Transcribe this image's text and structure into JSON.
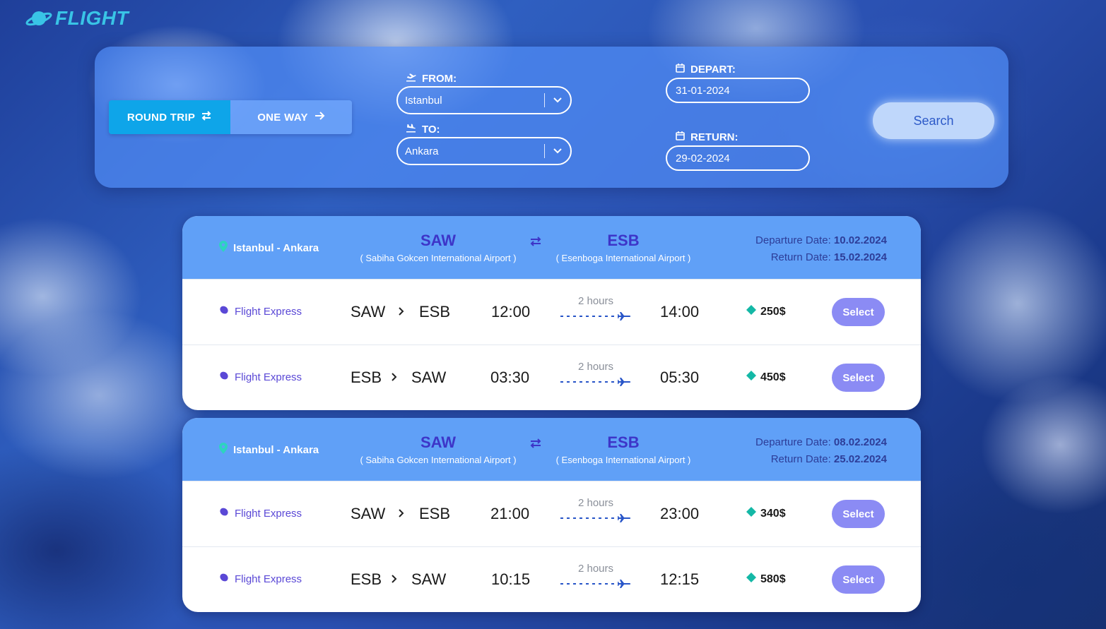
{
  "app": {
    "logo_text": "FLIGHT"
  },
  "search": {
    "trip_types": [
      {
        "label": "ROUND TRIP",
        "active": true
      },
      {
        "label": "ONE WAY",
        "active": false
      }
    ],
    "from_label": "FROM:",
    "from_value": "Istanbul",
    "to_label": "TO:",
    "to_value": "Ankara",
    "depart_label": "DEPART:",
    "depart_value": "31-01-2024",
    "return_label": "RETURN:",
    "return_value": "29-02-2024",
    "search_label": "Search"
  },
  "results": [
    {
      "route": "Istanbul - Ankara",
      "origin_code": "SAW",
      "origin_name": "( Sabiha Gokcen International Airport )",
      "dest_code": "ESB",
      "dest_name": "( Esenboga International Airport )",
      "departure_label": "Departure Date:",
      "departure_date": "10.02.2024",
      "return_label": "Return Date:",
      "return_date": "15.02.2024",
      "flights": [
        {
          "airline": "Flight Express",
          "from": "SAW",
          "to": "ESB",
          "depart": "12:00",
          "duration": "2 hours",
          "arrive": "14:00",
          "price": "250$",
          "action": "Select"
        },
        {
          "airline": "Flight Express",
          "from": "ESB",
          "to": "SAW",
          "depart": "03:30",
          "duration": "2 hours",
          "arrive": "05:30",
          "price": "450$",
          "action": "Select"
        }
      ]
    },
    {
      "route": "Istanbul - Ankara",
      "origin_code": "SAW",
      "origin_name": "( Sabiha Gokcen International Airport )",
      "dest_code": "ESB",
      "dest_name": "( Esenboga International Airport )",
      "departure_label": "Departure Date:",
      "departure_date": "08.02.2024",
      "return_label": "Return Date:",
      "return_date": "25.02.2024",
      "flights": [
        {
          "airline": "Flight Express",
          "from": "SAW",
          "to": "ESB",
          "depart": "21:00",
          "duration": "2 hours",
          "arrive": "23:00",
          "price": "340$",
          "action": "Select"
        },
        {
          "airline": "Flight Express",
          "from": "ESB",
          "to": "SAW",
          "depart": "10:15",
          "duration": "2 hours",
          "arrive": "12:15",
          "price": "580$",
          "action": "Select"
        }
      ]
    }
  ],
  "icons": {
    "logo": "planet-icon",
    "round_trip": "swap-arrows-icon",
    "one_way": "arrow-right-icon",
    "takeoff": "plane-takeoff-icon",
    "landing": "plane-landing-icon",
    "calendar": "calendar-icon",
    "location": "map-pin-icon",
    "airline": "airline-logo-icon",
    "price": "tag-icon"
  },
  "colors": {
    "accent_blue": "#0ea5e9",
    "card_header": "#60a0f7",
    "code_purple": "#3d35c8",
    "select_button": "#8b8bf4",
    "logo": "#39c4e6",
    "price_tag": "#14b8a6"
  }
}
